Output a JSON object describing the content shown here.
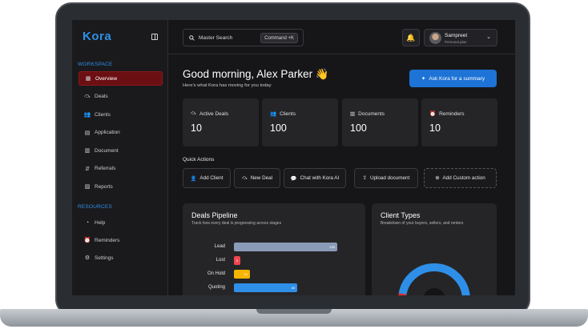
{
  "app": {
    "logo": "Kora"
  },
  "sidebar": {
    "workspace_label": "WORKSPACE",
    "resources_label": "RESOURCES",
    "workspace_items": [
      {
        "label": "Overview",
        "icon": "overview-icon",
        "glyph": "▦",
        "active": true
      },
      {
        "label": "Deals",
        "icon": "handshake-icon",
        "glyph": "⤼",
        "active": false
      },
      {
        "label": "Clients",
        "icon": "users-icon",
        "glyph": "👥",
        "active": false
      },
      {
        "label": "Application",
        "icon": "clipboard-icon",
        "glyph": "▤",
        "active": false
      },
      {
        "label": "Document",
        "icon": "document-icon",
        "glyph": "▥",
        "active": false
      },
      {
        "label": "Referrals",
        "icon": "referral-icon",
        "glyph": "⇵",
        "active": false
      },
      {
        "label": "Reports",
        "icon": "chart-icon",
        "glyph": "▨",
        "active": false
      }
    ],
    "resource_items": [
      {
        "label": "Help",
        "icon": "help-icon",
        "glyph": "◔"
      },
      {
        "label": "Reminders",
        "icon": "alarm-icon",
        "glyph": "⏰"
      },
      {
        "label": "Settings",
        "icon": "gear-icon",
        "glyph": "⚙"
      }
    ]
  },
  "header": {
    "search_label": "Master Search",
    "search_shortcut": "Command +K",
    "user_name": "Sampreet",
    "user_plan": "Personal plan"
  },
  "main": {
    "greeting": "Good morning, Alex Parker 👋",
    "subtitle": "Here's what Kora has moving for you today",
    "ask_button": "Ask Kora for a summary",
    "stats": [
      {
        "label": "Active Deals",
        "value": "10",
        "icon": "handshake-icon",
        "glyph": "⤼"
      },
      {
        "label": "Clients",
        "value": "100",
        "icon": "users-icon",
        "glyph": "👥"
      },
      {
        "label": "Documents",
        "value": "100",
        "icon": "document-icon",
        "glyph": "▥"
      },
      {
        "label": "Reminders",
        "value": "10",
        "icon": "alarm-icon",
        "glyph": "⏰"
      }
    ],
    "quick_actions_title": "Quick Actions",
    "quick_actions": [
      {
        "label": "Add Client",
        "icon": "add-user-icon",
        "glyph": "👤"
      },
      {
        "label": "New Deal",
        "icon": "handshake-icon",
        "glyph": "⤼"
      },
      {
        "label": "Chat with Kora AI",
        "icon": "chat-icon",
        "glyph": "💬"
      },
      {
        "label": "Upload document",
        "icon": "upload-icon",
        "glyph": "⇪"
      },
      {
        "label": "Add Custom action",
        "icon": "plus-circle-icon",
        "glyph": "⊕"
      }
    ],
    "deals_pipeline": {
      "title": "Deals Pipeline",
      "subtitle": "Track how every deal is progressing across stages"
    },
    "client_types": {
      "title": "Client Types",
      "subtitle": "Breakdown of your buyers, sellers, and renters"
    }
  },
  "chart_data": [
    {
      "type": "bar",
      "orientation": "horizontal",
      "categories": [
        "Lead",
        "Lost",
        "On Hold",
        "Quoting"
      ],
      "values": [
        130,
        5,
        20,
        80
      ],
      "value_labels": [
        "130",
        "5",
        "20",
        "80"
      ],
      "colors": [
        "#8a9bb8",
        "#f0474f",
        "#f5b400",
        "#2f8fe8"
      ],
      "xlim": [
        0,
        130
      ]
    },
    {
      "type": "pie",
      "style": "donut",
      "colors": [
        "#2f8fe8",
        "#e52e2e",
        "#f5b400"
      ]
    }
  ],
  "colors": {
    "accent": "#1d73d6",
    "active_nav": "#6b0f12",
    "logo": "#2f8fe8"
  }
}
